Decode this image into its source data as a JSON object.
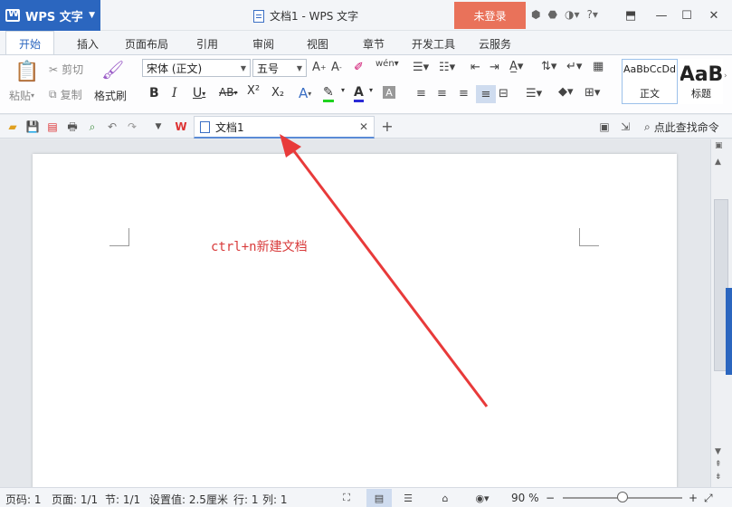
{
  "app": {
    "name": "WPS 文字",
    "window_title": "文档1 - WPS 文字",
    "login": "未登录"
  },
  "ribbon_tabs": [
    "开始",
    "插入",
    "页面布局",
    "引用",
    "审阅",
    "视图",
    "章节",
    "开发工具",
    "云服务"
  ],
  "clipboard": {
    "paste": "粘贴",
    "cut": "剪切",
    "copy": "复制",
    "format_painter": "格式刷"
  },
  "font": {
    "name": "宋体 (正文)",
    "size": "五号"
  },
  "styles": [
    {
      "sample": "AaBbCcDd",
      "name": "正文"
    },
    {
      "sample": "AaB",
      "name": "标题"
    }
  ],
  "document_tab": {
    "title": "文档1"
  },
  "search": {
    "label": "点此查找命令"
  },
  "document": {
    "text": "ctrl+n新建文档"
  },
  "status": {
    "page_no": "页码: 1",
    "pages": "页面: 1/1",
    "section": "节: 1/1",
    "setting": "设置值: 2.5厘米",
    "row": "行: 1",
    "col": "列: 1",
    "zoom": "90 %"
  },
  "zoom_level": 0.5,
  "colors": {
    "accent": "#2b66bf",
    "login_bg": "#e9725a",
    "annotation": "#e83a3a"
  }
}
